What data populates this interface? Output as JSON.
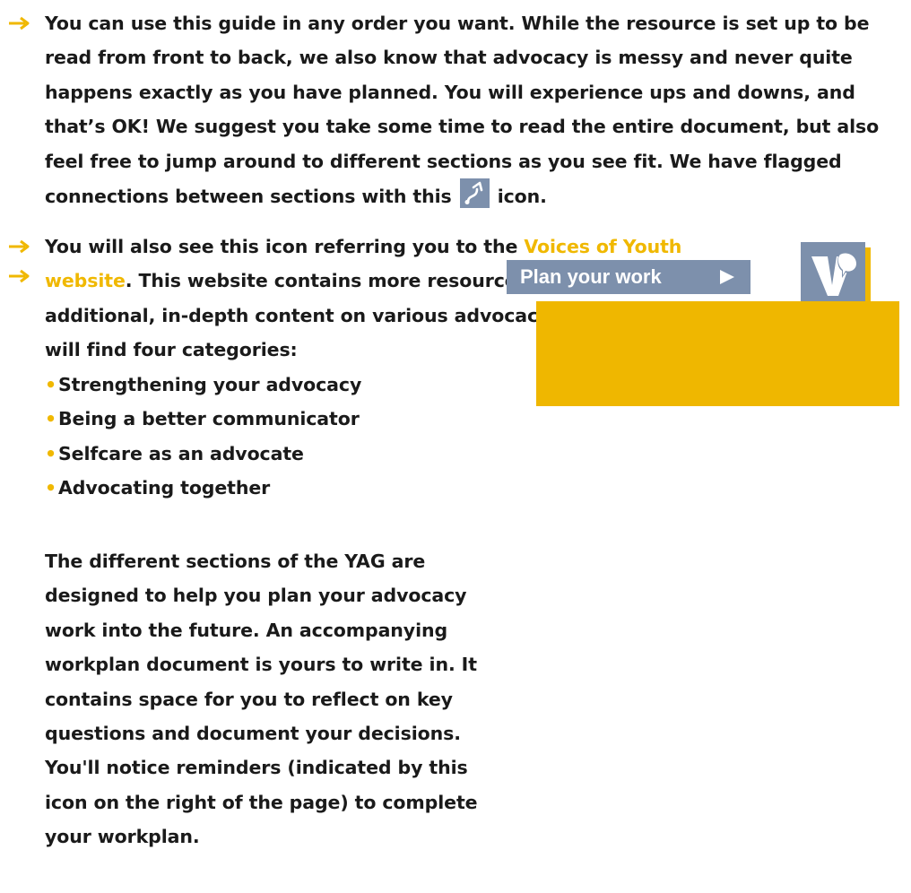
{
  "section1": {
    "text": "You can use this guide in any order you want. While the resource is set up to be read from front to back, we also know that advocacy is messy and never quite happens exactly as you have planned. You will experience ups and downs, and that’s OK! We suggest you take some time to read the entire document, but also feel free to jump around to different sections as you see fit. We have flagged connections between sections with this",
    "text_end": "icon.",
    "icon": "connection-arrow-icon"
  },
  "section2": {
    "text_start": "You will also see this icon referring you to the",
    "link": "Voices of Youth website",
    "text_mid": ". This website contains more resources for when you want additional, in-depth content on various advocacy subjects. Here, you will find four categories:",
    "bullets": [
      "Strengthening your advocacy",
      "Being a better communicator",
      "Selfcare as an advocate",
      "Advocating together"
    ],
    "icon": "voices-of-youth-logo-icon"
  },
  "section3": {
    "text": "The different sections of the YAG are designed to help you plan your advocacy work into the future. An accompanying workplan document is yours to write in. It contains space for you to reflect on key questions and document your decisions. You'll notice reminders (indicated by this icon on the right of the page) to complete your workplan.",
    "callout_label": "Plan your work",
    "callout_icon": "play-triangle-icon"
  },
  "colors": {
    "accent": "#f0b800",
    "slate": "#7d90ac",
    "text": "#1a1a1a"
  }
}
